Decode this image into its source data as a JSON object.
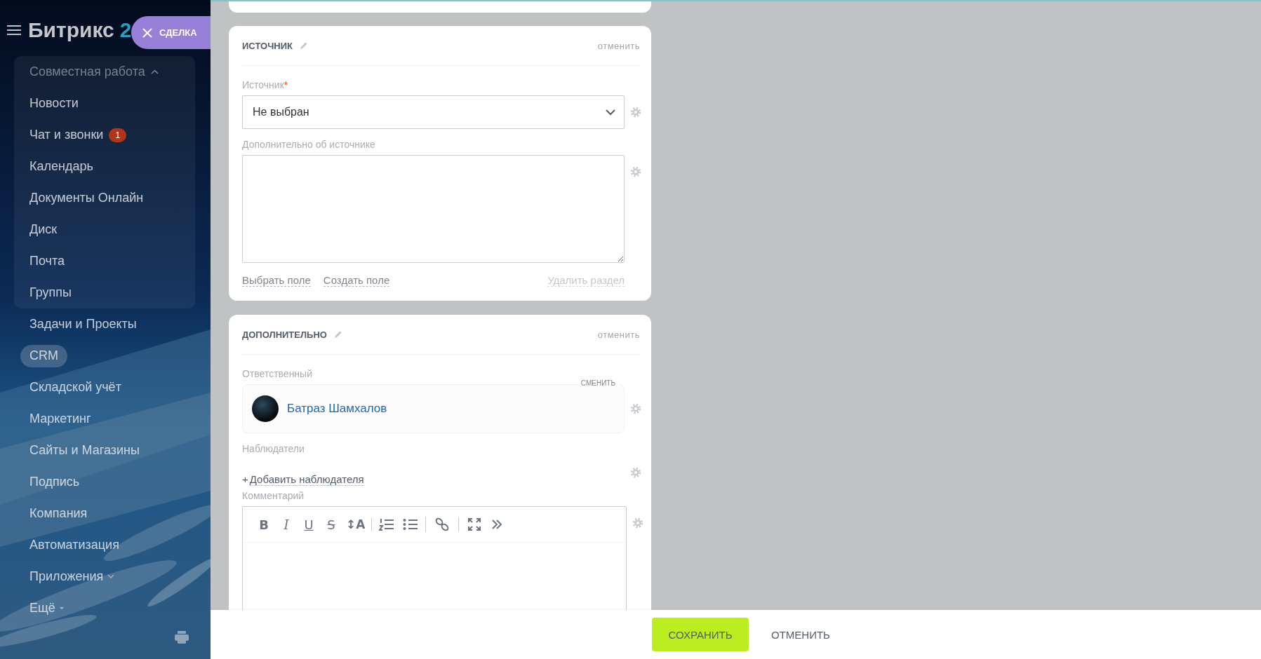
{
  "logo": {
    "text": "Битрикс",
    "number": "2"
  },
  "deal_tab": {
    "label": "СДЕЛКА"
  },
  "sidebar": {
    "group": {
      "title": "Совместная работа",
      "expanded": true,
      "items": [
        {
          "label": "Новости",
          "selected": false
        },
        {
          "label": "Чат и звонки",
          "selected": false,
          "badge": "1"
        },
        {
          "label": "Календарь",
          "selected": false
        },
        {
          "label": "Документы Онлайн",
          "selected": false
        },
        {
          "label": "Диск",
          "selected": false
        },
        {
          "label": "Почта",
          "selected": false
        },
        {
          "label": "Группы",
          "selected": false
        }
      ]
    },
    "items": [
      {
        "label": "Задачи и Проекты",
        "kind": "link",
        "selected": false
      },
      {
        "label": "CRM",
        "kind": "link",
        "selected": true
      },
      {
        "label": "Складской учёт",
        "kind": "link",
        "selected": false
      },
      {
        "label": "Маркетинг",
        "kind": "link",
        "selected": false
      },
      {
        "label": "Сайты и Магазины",
        "kind": "link",
        "selected": false
      },
      {
        "label": "Подпись",
        "kind": "link",
        "selected": false
      },
      {
        "label": "Компания",
        "kind": "link",
        "selected": false
      },
      {
        "label": "Автоматизация",
        "kind": "link",
        "selected": false
      },
      {
        "label": "Приложения",
        "kind": "dropdown",
        "selected": false
      },
      {
        "label": "Ещё",
        "kind": "more",
        "selected": false
      }
    ]
  },
  "sections": [
    {
      "title": "ИСТОЧНИК",
      "cancel": "отменить",
      "fields": [
        {
          "kind": "select",
          "label": "Источник",
          "required_mark": "*",
          "value": "Не выбран"
        },
        {
          "kind": "textarea",
          "label": "Дополнительно об источнике"
        }
      ],
      "links": [
        "Выбрать поле",
        "Создать поле"
      ],
      "delete": "Удалить раздел"
    },
    {
      "title": "ДОПОЛНИТЕЛЬНО",
      "cancel": "отменить",
      "fields": [
        {
          "kind": "user",
          "label": "Ответственный",
          "change": "СМЕНИТЬ",
          "name": "Батраз Шамхалов"
        },
        {
          "kind": "add",
          "label": "Наблюдатели",
          "prefix": "+",
          "action": "Добавить наблюдателя"
        },
        {
          "kind": "editor",
          "label": "Комментарий",
          "toolbar_groups": [
            {
              "buttons": [
                {
                  "kind": "bold",
                  "glyph": "B"
                },
                {
                  "kind": "italic",
                  "glyph": "I"
                },
                {
                  "kind": "underline",
                  "glyph": "U"
                },
                {
                  "kind": "strike",
                  "glyph": "S"
                },
                {
                  "kind": "font-size",
                  "glyph": "↕A"
                }
              ]
            },
            {
              "buttons": [
                {
                  "kind": "ordered-list"
                },
                {
                  "kind": "bullet-list"
                }
              ]
            },
            {
              "buttons": [
                {
                  "kind": "link"
                }
              ]
            },
            {
              "buttons": [
                {
                  "kind": "fullscreen"
                },
                {
                  "kind": "more"
                }
              ]
            }
          ]
        }
      ]
    }
  ],
  "footer": {
    "buttons": [
      {
        "label": "СОХРАНИТЬ",
        "kind": "primary"
      },
      {
        "label": "ОТМЕНИТЬ",
        "kind": "plain"
      }
    ]
  }
}
